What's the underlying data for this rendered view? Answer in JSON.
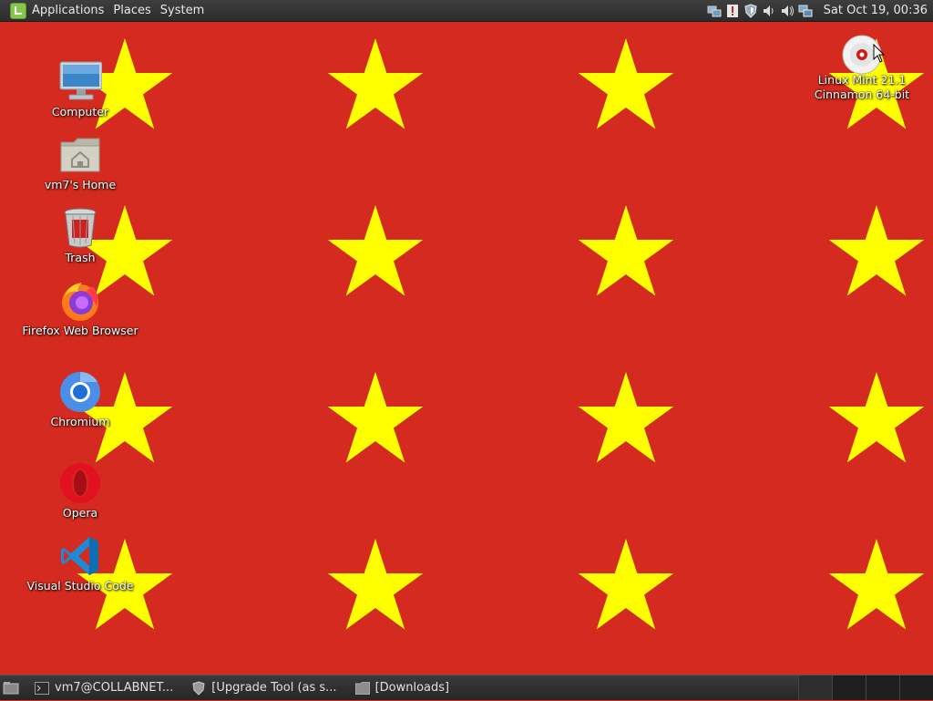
{
  "top_panel": {
    "menus": [
      "Applications",
      "Places",
      "System"
    ],
    "tray_icons": [
      "network-icon",
      "update-manager-icon",
      "shield-icon",
      "volume-icon",
      "speaker-icon",
      "network-wired-icon"
    ],
    "clock": "Sat Oct 19, 00:36"
  },
  "wallpaper": {
    "background_color": "#d42a1f",
    "star_color": "#ffff00"
  },
  "desktop_icons": {
    "computer": "Computer",
    "home": "vm7's Home",
    "trash": "Trash",
    "firefox": "Firefox Web Browser",
    "chromium": "Chromium",
    "opera": "Opera",
    "vscode": "Visual Studio Code",
    "disc_line1": "Linux Mint 21.1",
    "disc_line2": "Cinnamon 64-bit"
  },
  "taskbar": {
    "tasks": [
      {
        "label": "vm7@COLLABNET...",
        "icon": "terminal-icon"
      },
      {
        "label": "[Upgrade Tool (as s...",
        "icon": "shield-icon"
      },
      {
        "label": "[Downloads]",
        "icon": "folder-icon"
      }
    ]
  }
}
